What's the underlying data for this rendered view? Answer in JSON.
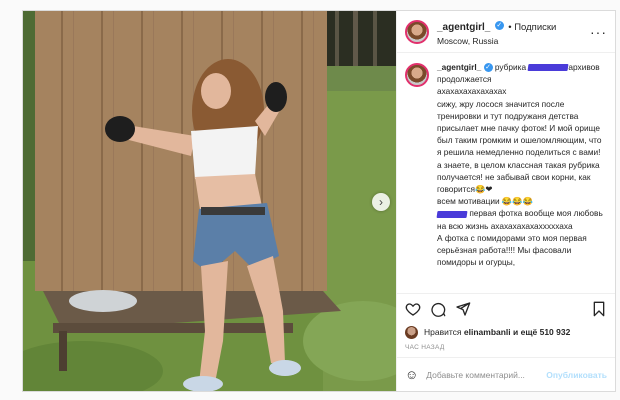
{
  "header": {
    "username": "_agentgirl_",
    "follow_label": "• Подписки",
    "location": "Moscow, Russia",
    "more_icon": "more-horizontal-icon"
  },
  "caption": {
    "username": "_agentgirl_",
    "prefix": "рубрика",
    "suffix": "архивов продолжается",
    "lines": [
      "ахахахахахахахах",
      "сижу, жру лосося значится после тренировки и тут подружаня детства присылает мне пачку фоток! И мой орище был таким громким и ошеломляющим, что я решила немедленно поделиться с вами!",
      "а знаете, в целом классная такая рубрика получается! не забывай свои корни, как говорится😂❤",
      "всем мотивации 😂😂😂"
    ],
    "redacted_line_rest": "первая фотка вообще моя любовь на всю жизнь ахахахахахахххххаха",
    "lines_after": [
      "А фотка с помидорами это моя первая серьёзная работа!!!! Мы фасовали помидоры и огурцы,"
    ]
  },
  "actions": {
    "icons": [
      "heart-icon",
      "comment-icon",
      "share-icon",
      "bookmark-icon"
    ]
  },
  "likes": {
    "prefix": "Нравится",
    "user": "elinambanli",
    "suffix": "и ещё 510 932"
  },
  "time_label": "ЧАС НАЗАД",
  "comment": {
    "placeholder": "Добавьте комментарий...",
    "post_label": "Опубликовать"
  },
  "colors": {
    "accent_blue": "#3897f0",
    "story_ring": "#e1306c",
    "redaction": "#4a3bd9"
  }
}
